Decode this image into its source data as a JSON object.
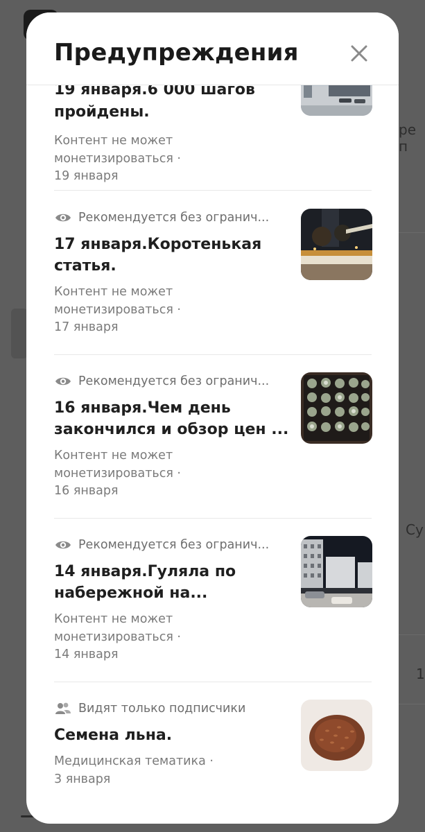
{
  "background": {
    "fragments": [
      "ре п",
      "Су",
      "1"
    ]
  },
  "modal": {
    "title": "Предупреждения",
    "close_icon": "close-icon"
  },
  "items": [
    {
      "badge_icon": "",
      "badge": "",
      "title_partial": "19 января.6 000 шагов",
      "title": "пройдены.",
      "meta_lines": [
        "Контент не может",
        "монетизироваться ·",
        "19 января"
      ],
      "thumb": "street-winter-photo"
    },
    {
      "badge_icon": "eye-icon",
      "badge": "Рекомендуется без огранич...",
      "title_lines": [
        "17 января.Коротенькая",
        "статья."
      ],
      "meta_lines": [
        "Контент не может",
        "монетизироваться ·",
        "17 января"
      ],
      "thumb": "night-park-photo"
    },
    {
      "badge_icon": "eye-icon",
      "badge": "Рекомендуется без огранич...",
      "title_lines": [
        "16 января.Чем день",
        "закончился и обзор цен ..."
      ],
      "meta_lines": [
        "Контент не может",
        "монетизироваться ·",
        "16 января"
      ],
      "thumb": "cactus-tray-photo"
    },
    {
      "badge_icon": "eye-icon",
      "badge": "Рекомендуется без огранич...",
      "title_lines": [
        "14 января.Гуляла по",
        "набережной на..."
      ],
      "meta_lines": [
        "Контент не может",
        "монетизироваться ·",
        "14 января"
      ],
      "thumb": "embankment-buildings-photo"
    },
    {
      "badge_icon": "subscribers-icon",
      "badge": "Видят только подписчики",
      "title_lines": [
        "Семена льна."
      ],
      "meta_lines": [
        "Медицинская тематика ·",
        "3 января"
      ],
      "thumb": "flax-seeds-photo"
    }
  ]
}
